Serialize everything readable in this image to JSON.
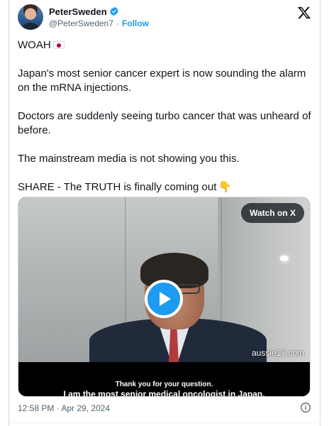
{
  "author": {
    "display_name": "PeterSweden",
    "handle": "@PeterSweden7",
    "follow_label": "Follow",
    "verified": true
  },
  "tweet": {
    "paragraphs": [
      "WOAH",
      "Japan's most senior cancer expert is now sounding the alarm on the mRNA injections.",
      "Doctors are suddenly seeing turbo cancer that was unheard of before.",
      "The mainstream media is not showing you this.",
      "SHARE - The TRUTH is finally coming out"
    ]
  },
  "media": {
    "watch_label": "Watch on X",
    "watermark": "aussie17.com",
    "subtitle_line1": "Thank you for your question.",
    "subtitle_line2": "I am the most senior medical oncologist in Japan."
  },
  "footer": {
    "timestamp": "12:58 PM · Apr 29, 2024"
  },
  "colors": {
    "accent": "#1d9bf0",
    "text": "#0f1419",
    "muted": "#536471"
  },
  "icons": {
    "verified": "verified-badge-icon",
    "x_logo": "x-logo-icon",
    "play": "play-icon",
    "info": "info-icon"
  }
}
